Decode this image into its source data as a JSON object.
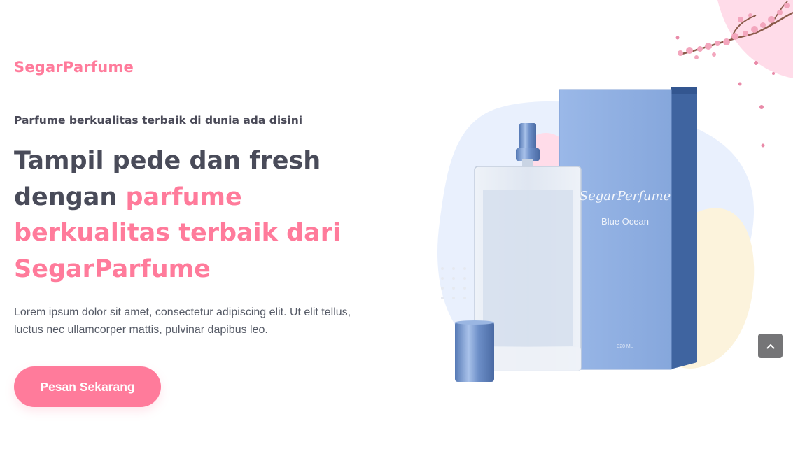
{
  "brand": {
    "name": "SegarParfume"
  },
  "hero": {
    "tagline": "Parfume berkualitas terbaik di dunia ada disini",
    "headline_plain": "Tampil pede dan fresh dengan ",
    "headline_highlight": "parfume berkualitas terbaik dari SegarParfume",
    "description": "Lorem ipsum dolor sit amet, consectetur adipiscing elit. Ut elit tellus, luctus nec ullamcorper mattis, pulvinar dapibus leo.",
    "cta_label": "Pesan Sekarang"
  },
  "product": {
    "box_brand": "SegarPerfume",
    "box_variant": "Blue Ocean",
    "box_volume": "320 ML"
  },
  "scroll_top": {
    "icon": "chevron-up-icon"
  },
  "colors": {
    "accent": "#ff7b9b",
    "heading": "#494b59",
    "body_text": "#555a66",
    "box_blue": "#8fb0e3",
    "box_side": "#3f64a0",
    "blob_blue": "#e9f0fd",
    "blob_yellow": "#fcf3dc",
    "blob_pink": "#ffdce9",
    "scroll_button": "#757577"
  }
}
